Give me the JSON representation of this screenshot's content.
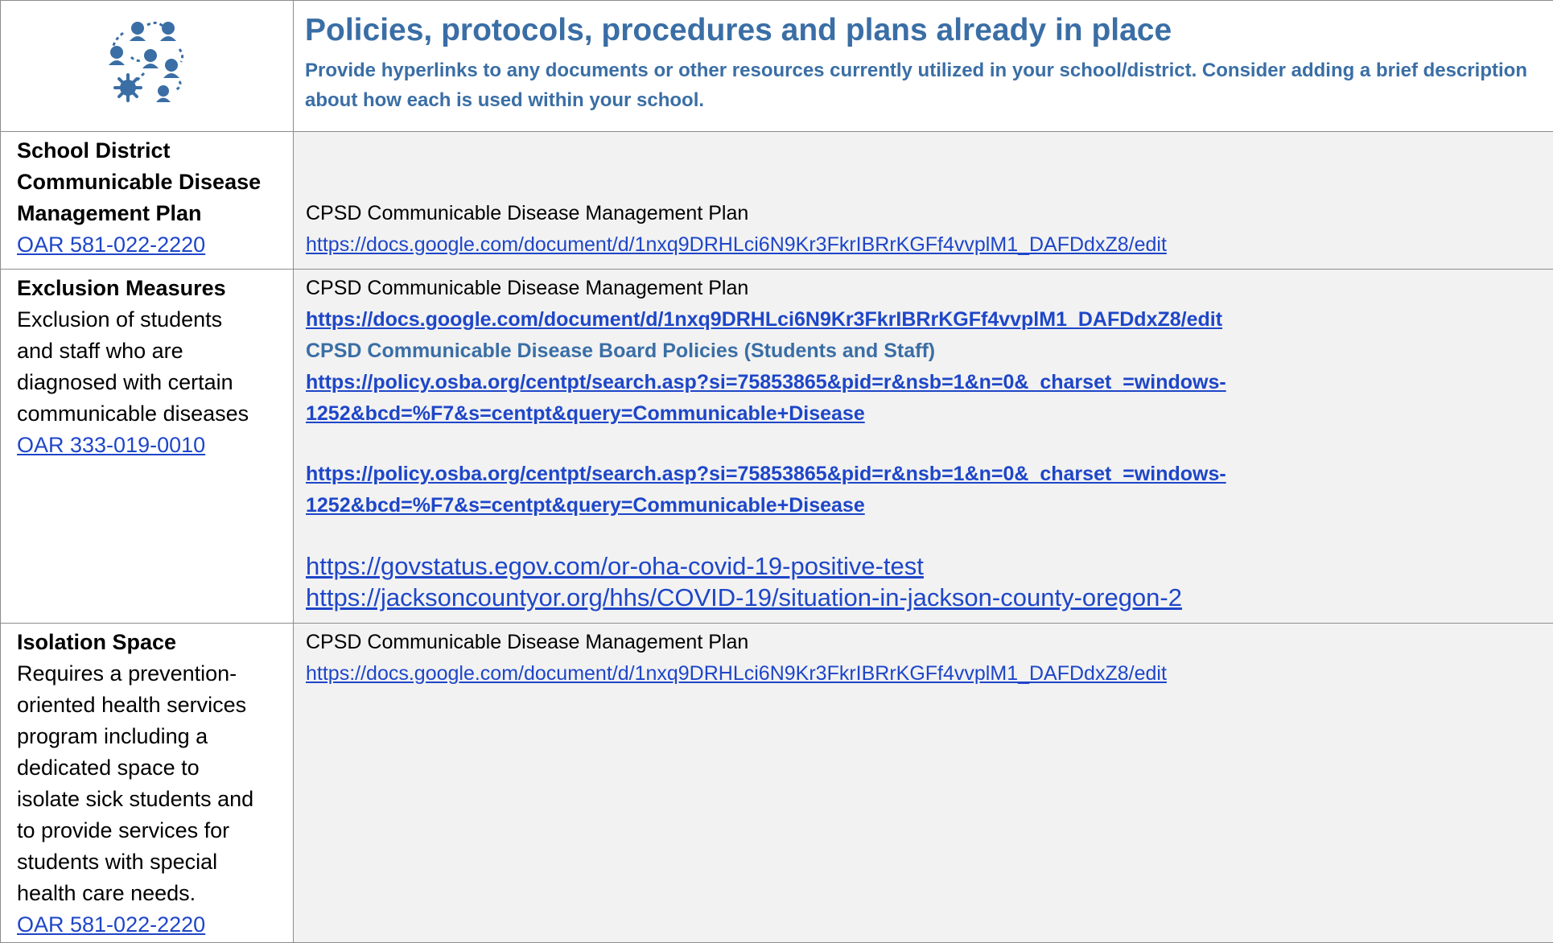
{
  "header": {
    "title": "Policies, protocols, procedures and plans already in place",
    "subtitle": "Provide hyperlinks to any documents or other resources currently utilized in your school/district. Consider adding a brief description about how each is used within your school.",
    "icon": "people-network-virus-icon",
    "accent_color": "#3a6ea5",
    "link_color": "#1e46c8"
  },
  "rows": [
    {
      "label_lines": [
        "School District",
        "Communicable Disease",
        "Management Plan"
      ],
      "oar": "OAR 581-022-2220",
      "plan_name": "CPSD Communicable Disease Management Plan",
      "plan_url": "https://docs.google.com/document/d/1nxq9DRHLci6N9Kr3FkrIBRrKGFf4vvplM1_DAFDdxZ8/edit"
    },
    {
      "label": "Exclusion Measures",
      "desc_lines": [
        "Exclusion of students",
        "and staff who are",
        "diagnosed with certain",
        "communicable diseases"
      ],
      "oar": "OAR 333-019-0010",
      "plan_name": "CPSD Communicable Disease Management Plan",
      "plan_url": "https://docs.google.com/document/d/1nxq9DRHLci6N9Kr3FkrIBRrKGFf4vvplM1_DAFDdxZ8/edit",
      "policies_title": "CPSD Communicable Disease Board Policies (Students and Staff)",
      "policy_url_1": "https://policy.osba.org/centpt/search.asp?si=75853865&pid=r&nsb=1&n=0&_charset_=windows-1252&bcd=%F7&s=centpt&query=Communicable+Disease",
      "policy_url_2": "https://policy.osba.org/centpt/search.asp?si=75853865&pid=r&nsb=1&n=0&_charset_=windows-1252&bcd=%F7&s=centpt&query=Communicable+Disease",
      "govstatus_url": "https://govstatus.egov.com/or-oha-covid-19-positive-test",
      "jackson_url": "https://jacksoncountyor.org/hhs/COVID-19/situation-in-jackson-county-oregon-2"
    },
    {
      "label": "Isolation Space",
      "desc_lines": [
        "Requires a prevention-",
        "oriented health services",
        "program including a",
        "dedicated space to",
        "isolate sick students and",
        "to provide services for",
        "students with special",
        "health care needs."
      ],
      "oar": "OAR 581-022-2220",
      "plan_name": "CPSD Communicable Disease Management Plan",
      "plan_url": "https://docs.google.com/document/d/1nxq9DRHLci6N9Kr3FkrIBRrKGFf4vvplM1_DAFDdxZ8/edit"
    }
  ]
}
